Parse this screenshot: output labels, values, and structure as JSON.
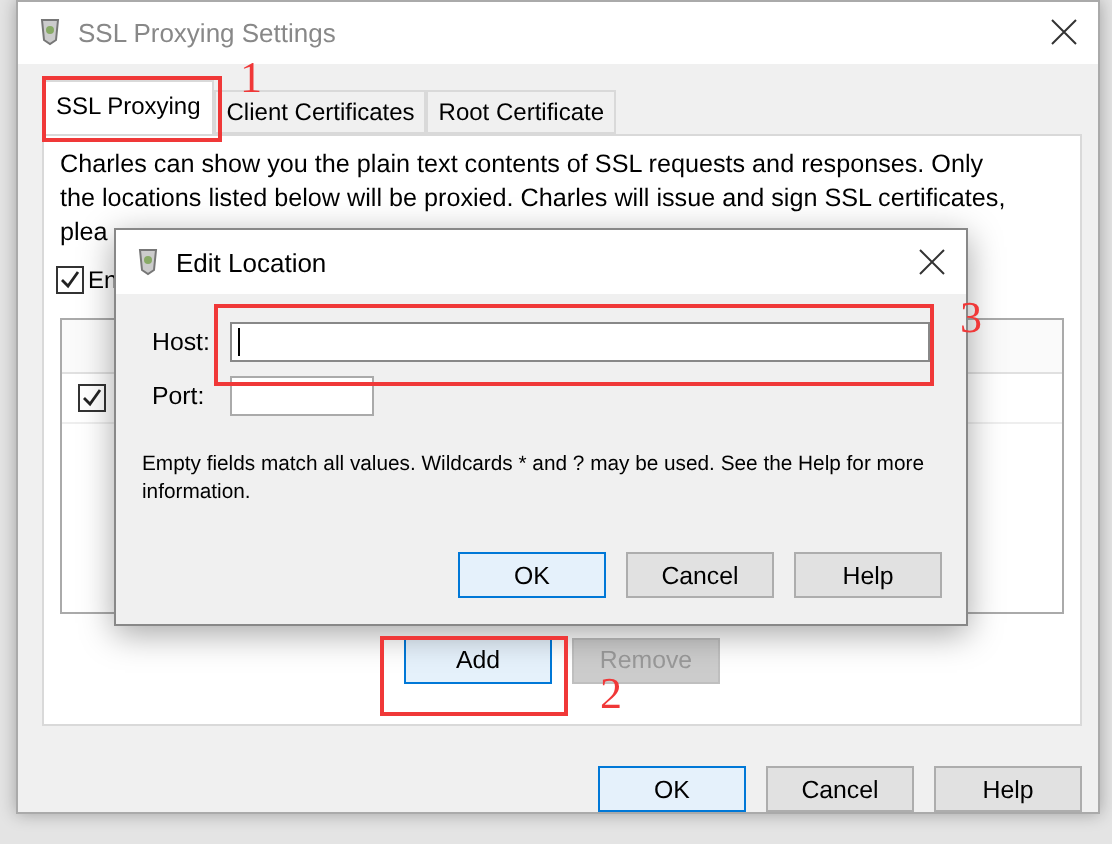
{
  "window": {
    "title": "SSL Proxying Settings"
  },
  "tabs": [
    {
      "label": "SSL Proxying",
      "selected": true
    },
    {
      "label": "Client Certificates",
      "selected": false
    },
    {
      "label": "Root Certificate",
      "selected": false
    }
  ],
  "description_lines": [
    "Charles can show you the plain text contents of SSL requests and responses. Only",
    "the locations listed below will be proxied. Charles will issue and sign SSL certificates,",
    "plea"
  ],
  "enable": {
    "label": "En",
    "checked": true
  },
  "locations": [
    {
      "checked": true
    }
  ],
  "list_buttons": [
    {
      "label": "Add",
      "disabled": false,
      "focused": true
    },
    {
      "label": "Remove",
      "disabled": true,
      "focused": false
    }
  ],
  "buttons": [
    {
      "label": "OK",
      "default": true
    },
    {
      "label": "Cancel",
      "default": false
    },
    {
      "label": "Help",
      "default": false
    }
  ],
  "edit_dialog": {
    "title": "Edit Location",
    "host": {
      "label": "Host:",
      "focused": true
    },
    "port": {
      "label": "Port:",
      "focused": false
    },
    "help": "Empty fields match all values. Wildcards * and ? may be used. See the Help for more information.",
    "buttons": [
      {
        "label": "OK",
        "default": true
      },
      {
        "label": "Cancel",
        "default": false
      },
      {
        "label": "Help",
        "default": false
      }
    ]
  },
  "annotations": [
    {
      "label": "1"
    },
    {
      "label": "2"
    },
    {
      "label": "3"
    }
  ]
}
